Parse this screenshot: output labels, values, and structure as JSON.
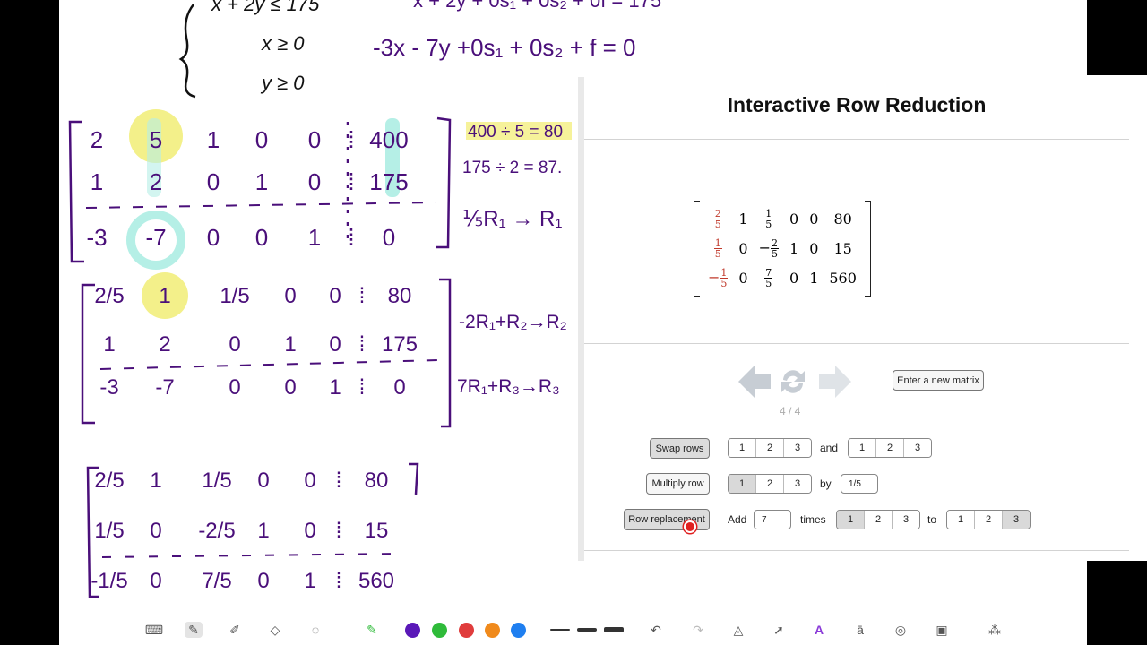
{
  "panel": {
    "title": "Interactive Row Reduction",
    "matrix": [
      [
        {
          "n": "2",
          "d": "5",
          "red": true
        },
        "1",
        {
          "n": "1",
          "d": "5"
        },
        "0",
        "0",
        "80"
      ],
      [
        {
          "n": "1",
          "d": "5",
          "red": true
        },
        "0",
        {
          "neg": true,
          "n": "2",
          "d": "5"
        },
        "1",
        "0",
        "15"
      ],
      [
        {
          "neg": true,
          "n": "1",
          "d": "5",
          "red": true
        },
        "0",
        {
          "n": "7",
          "d": "5"
        },
        "0",
        "1",
        "560"
      ]
    ],
    "counter": "4 / 4",
    "new_matrix_label": "Enter a new matrix",
    "swap_label": "Swap rows",
    "and_label": "and",
    "multiply_label": "Multiply row",
    "by_label": "by",
    "multiply_value": "1/5",
    "replace_label": "Row replacement",
    "add_label": "Add",
    "add_value": "7",
    "times_label": "times",
    "to_label": "to",
    "rows": [
      "1",
      "2",
      "3"
    ]
  },
  "handwriting": {
    "sys_line1": "x + 2y ≤ 175",
    "sys_line2": "x ≥  0",
    "sys_line3": "y ≥  0",
    "obj_eq": "-3x  - 7y  +0s₁ + 0s₂ + f  =  0",
    "m1": [
      [
        "2",
        "5",
        "1",
        "0",
        "0",
        "400"
      ],
      [
        "1",
        "2",
        "0",
        "1",
        "0",
        "175"
      ],
      [
        "-3",
        "-7",
        "0",
        "0",
        "1",
        "0"
      ]
    ],
    "note1": "400 ÷ 5 = 80",
    "note2": "175 ÷ 2 = 87.",
    "note3": "⅕R₁ → R₁",
    "m2": [
      [
        "2/5",
        "1",
        "1/5",
        "0",
        "0",
        "80"
      ],
      [
        "1",
        "2",
        "0",
        "1",
        "0",
        "175"
      ],
      [
        "-3",
        "-7",
        "0",
        "0",
        "1",
        "0"
      ]
    ],
    "op1": "-2R₁+R₂→R₂",
    "op2": "7R₁+R₃→R₃",
    "m3": [
      [
        "2/5",
        "1",
        "1/5",
        "0",
        "0",
        "80"
      ],
      [
        "1/5",
        "0",
        "-2/5",
        "1",
        "0",
        "15"
      ],
      [
        "-1/5",
        "0",
        "7/5",
        "0",
        "1",
        "560"
      ]
    ]
  },
  "colors": {
    "ink": "#4a0f7a",
    "yellow": "#f3f08a",
    "teal": "#b5efe6",
    "red": "#c0392b"
  },
  "toolbar": {
    "icons": [
      "keyboard-icon",
      "pen-icon",
      "highlighter-icon",
      "eraser-icon",
      "lasso-icon",
      "marker-icon",
      "undo-icon",
      "redo-icon",
      "shape-icon",
      "pointer-icon",
      "text-style-icon",
      "text-box-icon",
      "shapes-icon",
      "image-icon",
      "more-icon"
    ],
    "colors": [
      "#5a18b8",
      "#2fbb3a",
      "#e03c3c",
      "#f08a1c",
      "#1f7ff0"
    ]
  }
}
